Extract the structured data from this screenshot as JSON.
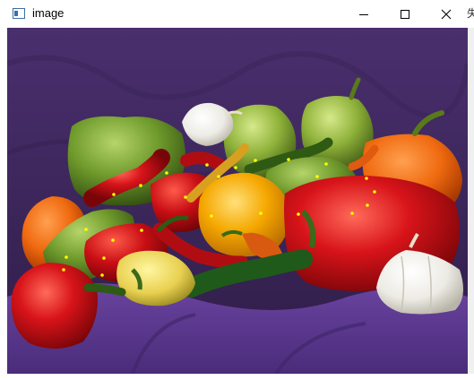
{
  "window": {
    "title": "image",
    "icon": "opencv-window-icon",
    "controls": {
      "minimize_icon": "minimize-icon",
      "maximize_icon": "maximize-icon",
      "close_icon": "close-icon"
    }
  },
  "behind_window_fragment": "失",
  "image": {
    "subject": "peppers",
    "keypoint_color": "#ffff00",
    "keypoint_count": 25
  },
  "colors": {
    "background_cloth": "#3b2a5e",
    "table_cloth": "#5a3a8a",
    "keypoint": "#ffff00"
  }
}
